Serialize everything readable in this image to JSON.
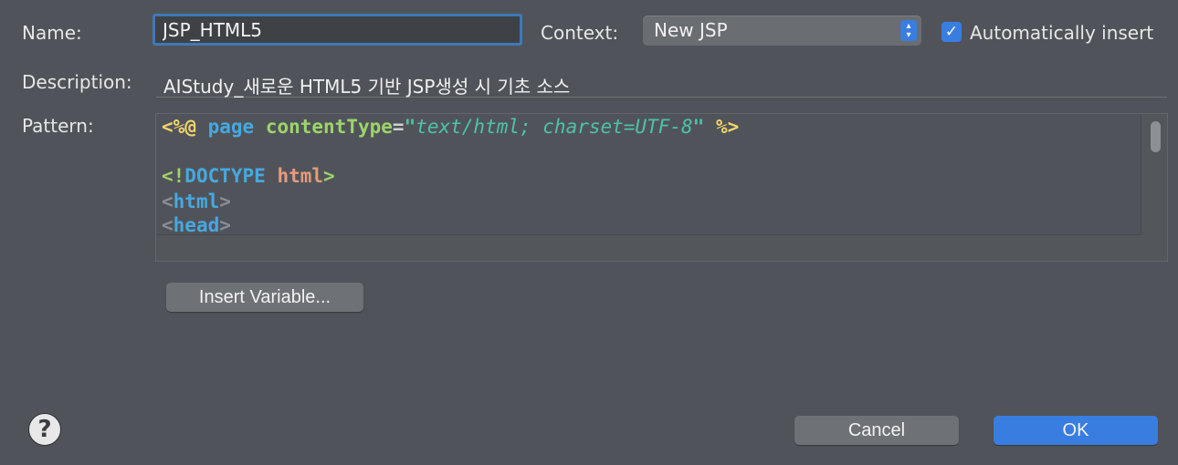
{
  "form": {
    "name_label": "Name:",
    "name_value": "JSP_HTML5",
    "context_label": "Context:",
    "context_value": "New JSP",
    "auto_insert_label": "Automatically insert",
    "auto_insert_checked": true,
    "description_label": "Description:",
    "description_value": "AIStudy_새로운 HTML5 기반 JSP생성 시 기초 소스",
    "pattern_label": "Pattern:"
  },
  "pattern_lines": [
    {
      "tokens": [
        {
          "text": "<%@",
          "color": "#f2d56a"
        },
        {
          "text": " ",
          "color": "#e4e4e4"
        },
        {
          "text": "page",
          "color": "#45a9e0"
        },
        {
          "text": " ",
          "color": "#e4e4e4"
        },
        {
          "text": "contentType",
          "color": "#9ed36a"
        },
        {
          "text": "=",
          "color": "#cfcfcf"
        },
        {
          "text": "\"",
          "color": "#4fc2a6"
        },
        {
          "text": "text/html; charset=UTF-8",
          "color": "#4fc2a6",
          "italic": true
        },
        {
          "text": "\"",
          "color": "#4fc2a6"
        },
        {
          "text": " ",
          "color": "#e4e4e4"
        },
        {
          "text": "%>",
          "color": "#f2d56a"
        }
      ]
    },
    {
      "tokens": []
    },
    {
      "tokens": [
        {
          "text": "<!",
          "color": "#9ed36a"
        },
        {
          "text": "DOCTYPE",
          "color": "#45a9e0"
        },
        {
          "text": " ",
          "color": "#e4e4e4"
        },
        {
          "text": "html",
          "color": "#e69a7e"
        },
        {
          "text": ">",
          "color": "#9ed36a"
        }
      ]
    },
    {
      "tokens": [
        {
          "text": "<",
          "color": "#8a8e93"
        },
        {
          "text": "html",
          "color": "#45a9e0"
        },
        {
          "text": ">",
          "color": "#8a8e93"
        }
      ]
    },
    {
      "tokens": [
        {
          "text": "<",
          "color": "#8a8e93"
        },
        {
          "text": "head",
          "color": "#45a9e0"
        },
        {
          "text": ">",
          "color": "#8a8e93"
        }
      ]
    }
  ],
  "buttons": {
    "insert_variable": "Insert Variable...",
    "cancel": "Cancel",
    "ok": "OK",
    "help": "?"
  },
  "icons": {
    "stepper": "up-down-chevron-icon",
    "checkmark": "checkmark-icon",
    "help": "question-mark-icon"
  },
  "colors": {
    "accent": "#3a7de0",
    "background": "#50545a",
    "focus_ring": "#3f79b8"
  }
}
